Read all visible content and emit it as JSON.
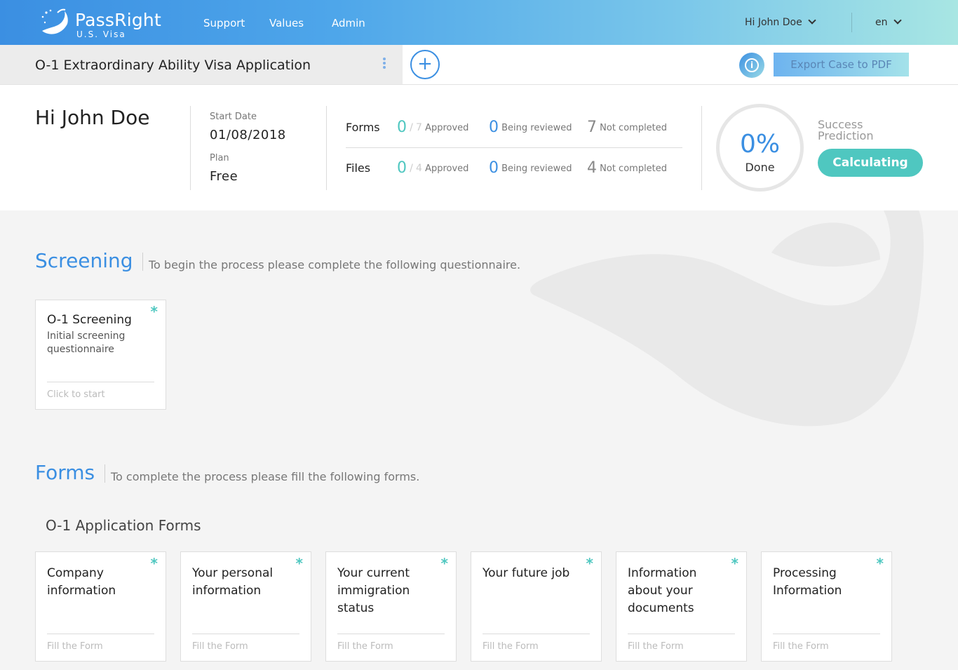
{
  "header": {
    "brand": "PassRight",
    "brand_sub": "U.S. Visa",
    "nav": [
      "Support",
      "Values",
      "Admin"
    ],
    "user_menu": "Hi John Doe",
    "language": "en"
  },
  "case": {
    "title": "O-1 Extraordinary Ability Visa Application",
    "add_label": "+",
    "info_label": "i",
    "export_label": "Export Case to PDF"
  },
  "summary": {
    "greeting": "Hi John Doe",
    "start_date_label": "Start Date",
    "start_date": "01/08/2018",
    "plan_label": "Plan",
    "plan": "Free",
    "forms": {
      "label": "Forms",
      "approved": "0",
      "total": "7",
      "approved_label": "Approved",
      "reviewing": "0",
      "reviewing_label": "Being reviewed",
      "incomplete": "7",
      "incomplete_label": "Not completed"
    },
    "files": {
      "label": "Files",
      "approved": "0",
      "total": "4",
      "approved_label": "Approved",
      "reviewing": "0",
      "reviewing_label": "Being reviewed",
      "incomplete": "4",
      "incomplete_label": "Not completed"
    },
    "progress_pct": "0%",
    "progress_label": "Done",
    "success_label": "Success Prediction",
    "success_button": "Calculating"
  },
  "screening": {
    "title": "Screening",
    "description": "To begin the process please complete the following questionnaire.",
    "card": {
      "title": "O-1 Screening",
      "subtitle": "Initial screening questionnaire",
      "cta": "Click to start",
      "marker": "*"
    }
  },
  "forms_section": {
    "title": "Forms",
    "description": "To complete the process please fill the following forms.",
    "group_title": "O-1 Application Forms",
    "cards": [
      {
        "title": "Company information",
        "cta": "Fill the Form",
        "marker": "*"
      },
      {
        "title": "Your personal information",
        "cta": "Fill the Form",
        "marker": "*"
      },
      {
        "title": "Your current immigration status",
        "cta": "Fill the Form",
        "marker": "*"
      },
      {
        "title": "Your future job",
        "cta": "Fill the Form",
        "marker": "*"
      },
      {
        "title": "Information about your documents",
        "cta": "Fill the Form",
        "marker": "*"
      },
      {
        "title": "Processing Information",
        "cta": "Fill the Form",
        "marker": "*"
      }
    ]
  },
  "colors": {
    "brand_blue": "#3b8fe2",
    "teal": "#4fc7c0"
  }
}
